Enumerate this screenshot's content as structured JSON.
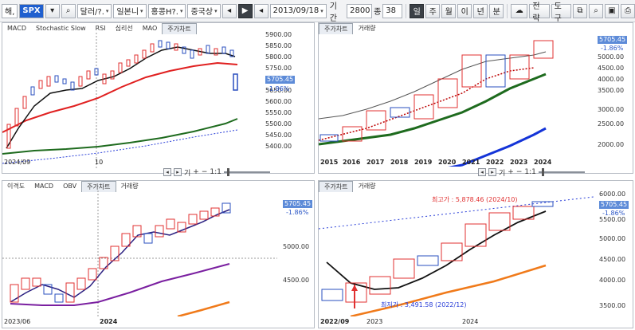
{
  "toolbar": {
    "window_label": "해,",
    "symbol": "SPX",
    "index_selects": [
      "달러/?.",
      "일본니",
      "홍콩H?.",
      "중국상"
    ],
    "date": "2013/09/18",
    "period_label": "기간",
    "period_value": "2800",
    "count_label": "종",
    "count_value": "38",
    "interval_buttons": [
      "일",
      "주",
      "월",
      "이",
      "년",
      "분"
    ],
    "strategy_label": "전략",
    "tools_label": "도구"
  },
  "panels": {
    "daily": {
      "tabs": [
        "MACD",
        "Stochastic Slow",
        "RSI",
        "심리선",
        "MAO",
        "주가차트"
      ],
      "active_tab": "주가차트",
      "yticks": [
        "5900.00",
        "5850.00",
        "5800.00",
        "5750.00",
        "5700.00",
        "5650.00",
        "5600.00",
        "5550.00",
        "5500.00",
        "5450.00",
        "5400.00"
      ],
      "price": "5705.45",
      "pct": "-1.86%",
      "x_labels": [
        "2024/09",
        "10"
      ]
    },
    "yearly": {
      "tabs": [
        "주가차트",
        "거래량"
      ],
      "active_tab": "주가차트",
      "yticks": [
        "5000.00",
        "4500.00",
        "4000.00",
        "3500.00",
        "3000.00",
        "2500.00",
        "2000.00"
      ],
      "price": "5705.45",
      "pct": "-1.86%",
      "x_labels": [
        "2015",
        "2016",
        "2017",
        "2018",
        "2019",
        "2020",
        "2021",
        "2022",
        "2023",
        "2024"
      ]
    },
    "monthly": {
      "tabs": [
        "이격도",
        "MACD",
        "OBV",
        "주가차트",
        "거래량"
      ],
      "active_tab": "주가차트",
      "yticks": [
        "5000.00",
        "4500.00"
      ],
      "price": "5705.45",
      "pct": "-1.86%",
      "x_labels": [
        "2023/06",
        "2024"
      ]
    },
    "weekly": {
      "tabs": [
        "주가차트",
        "거래량"
      ],
      "active_tab": "주가차트",
      "yticks": [
        "6000.00",
        "5500.00",
        "5000.00",
        "4500.00",
        "4000.00",
        "3500.00"
      ],
      "price": "5705.45",
      "pct": "-1.86%",
      "x_labels": [
        "2022/09",
        "2023",
        "2024"
      ],
      "high_annotation": "최고가 : 5,878.46 (2024/10)",
      "low_annotation": "최저가 : 3,491.58 (2022/12)"
    }
  },
  "scroll_controls": {
    "labels": [
      "기",
      "1:1"
    ],
    "icons": [
      "prev-icon",
      "next-icon",
      "zoom-in-icon",
      "zoom-out-icon"
    ]
  },
  "colors": {
    "up_candle": "#e03030",
    "down_candle": "#2a4fbf",
    "ma_short": "#111111",
    "ma_mid": "#e02020",
    "ma_long": "#1e6b1e",
    "ma_dashed": "#2a3fd8",
    "ma_purple": "#7a1fa0",
    "ma_orange": "#f07a1a",
    "ma_blue": "#1434d8"
  }
}
